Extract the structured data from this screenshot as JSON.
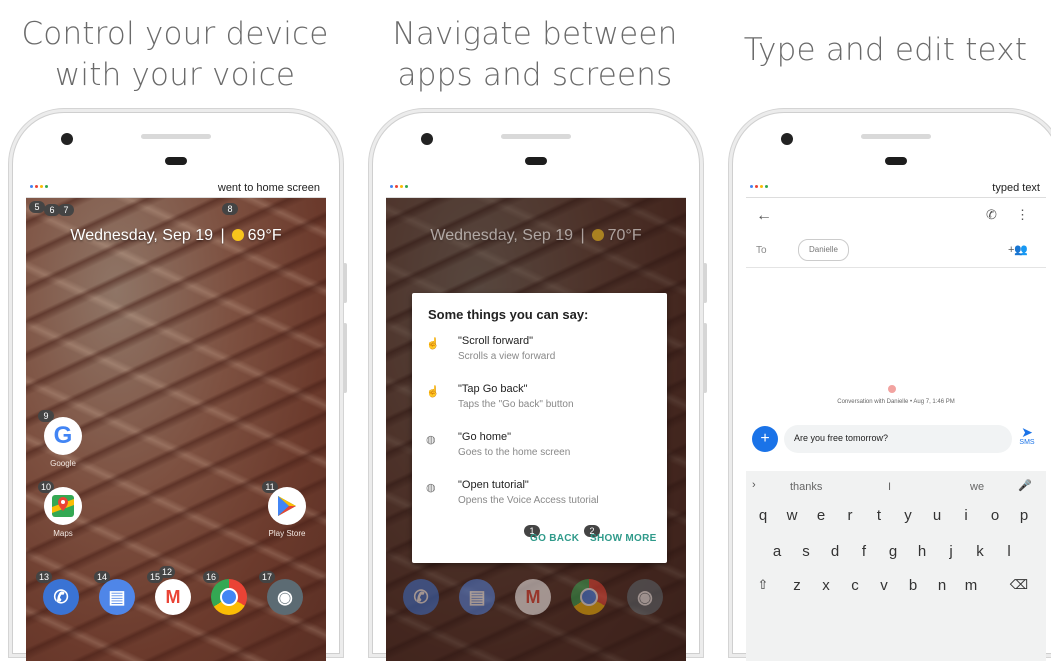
{
  "panels": [
    {
      "caption_line1": "Control your device",
      "caption_line2": "with your voice",
      "status_text": "went to home screen",
      "date_text": "Wednesday, Sep 19",
      "temp_text": "69°F",
      "tags": [
        "5",
        "6",
        "7",
        "8",
        "9",
        "10",
        "11",
        "12",
        "13",
        "14",
        "15",
        "16",
        "17"
      ],
      "apps": {
        "google_label": "Google",
        "maps_label": "Maps",
        "play_label": "Play Store"
      }
    },
    {
      "caption_line1": "Navigate between",
      "caption_line2": "apps and screens",
      "date_text": "Wednesday, Sep 19",
      "temp_text": "70°F",
      "dialog": {
        "title": "Some things you can say:",
        "commands": [
          {
            "title": "\"Scroll  forward\"",
            "sub": "Scrolls a view forward"
          },
          {
            "title": "\"Tap Go back\"",
            "sub": "Taps the \"Go back\" button"
          },
          {
            "title": "\"Go home\"",
            "sub": "Goes to the home screen"
          },
          {
            "title": "\"Open tutorial\"",
            "sub": "Opens the Voice Access tutorial"
          }
        ],
        "back_label": "GO BACK",
        "more_label": "SHOW MORE",
        "back_tag": "1",
        "more_tag": "2"
      }
    },
    {
      "caption_line1": "Type and edit text",
      "status_text": "typed text",
      "to_label": "To",
      "recipient": "Danielle",
      "conversation_text": "Conversation with Danielle • Aug 7, 1:46 PM",
      "message_text": "Are you free tomorrow?",
      "sms_label": "SMS",
      "suggestions": [
        "thanks",
        "I",
        "we"
      ],
      "rows": [
        [
          "q",
          "w",
          "e",
          "r",
          "t",
          "y",
          "u",
          "i",
          "o",
          "p"
        ],
        [
          "a",
          "s",
          "d",
          "f",
          "g",
          "h",
          "j",
          "k",
          "l"
        ],
        [
          "z",
          "x",
          "c",
          "v",
          "b",
          "n",
          "m"
        ]
      ],
      "digit_hints": [
        "1",
        "2",
        "3",
        "4",
        "5",
        "6",
        "7",
        "8",
        "9",
        "0"
      ]
    }
  ],
  "colors": {
    "google_blue": "#4285f4",
    "google_red": "#ea4335",
    "google_yellow": "#fbbc05",
    "google_green": "#34a853",
    "teal": "#2f9a8a",
    "send_blue": "#1a73e8"
  }
}
